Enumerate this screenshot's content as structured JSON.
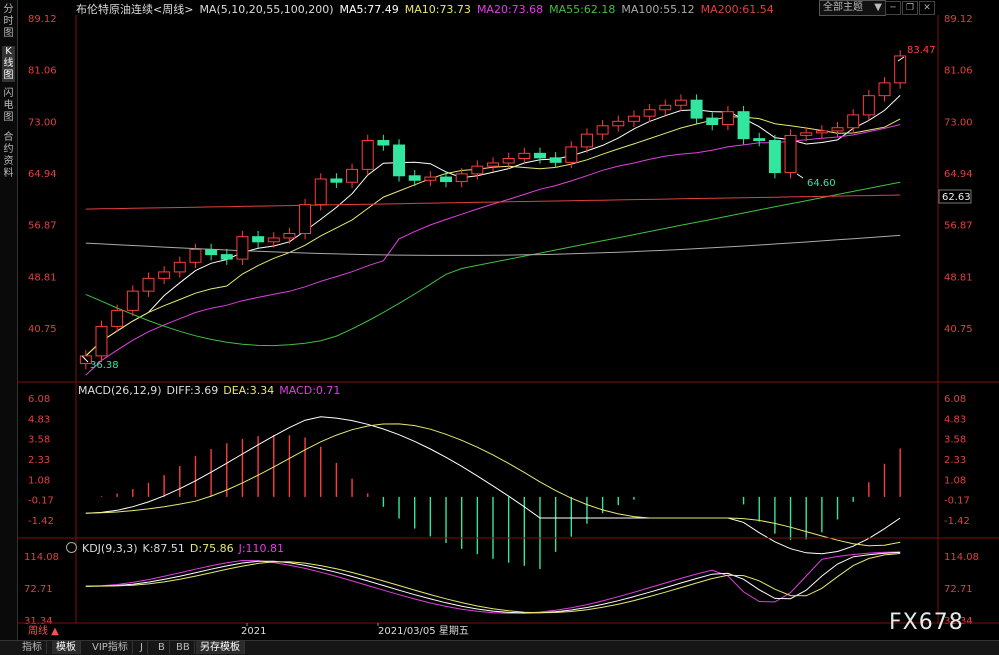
{
  "sidebar": {
    "tabs": [
      {
        "label": "分时图",
        "active": false
      },
      {
        "label": "K线图",
        "active": true
      },
      {
        "label": "闪电图",
        "active": false
      },
      {
        "label": "合约资料",
        "active": false
      }
    ]
  },
  "header": {
    "title": "布伦特原油连续<周线>",
    "ma_label": "MA(5,10,20,55,100,200)",
    "ma5": "MA5:77.49",
    "ma10": "MA10:73.73",
    "ma20": "MA20:73.68",
    "ma55": "MA55:62.18",
    "ma100": "MA100:55.12",
    "ma200": "MA200:61.54",
    "theme": "全部主题",
    "theme_arrow": "▼"
  },
  "colors": {
    "up": "#ff3c3c",
    "down": "#33e6a0",
    "ma5": "#ffffff",
    "ma10": "#e8e870",
    "ma20": "#e040e0",
    "ma55": "#40c040",
    "ma100": "#aaaaaa",
    "ma200": "#e04040",
    "grid": "#7a1010",
    "axis_text": "#e04040"
  },
  "main_chart": {
    "y_ticks": [
      "89.12",
      "81.06",
      "73.00",
      "64.94",
      "56.87",
      "48.81",
      "40.75"
    ],
    "last_price": "62.63",
    "annotations": {
      "high": "83.47",
      "low": "36.38",
      "local_low": "64.60"
    }
  },
  "macd": {
    "header": "MACD(26,12,9)",
    "diff": "DIFF:3.69",
    "dea": "DEA:3.34",
    "macd": "MACD:0.71",
    "y_ticks": [
      "6.08",
      "4.83",
      "3.58",
      "2.33",
      "1.08",
      "-0.17",
      "-1.42"
    ]
  },
  "kdj": {
    "header": "KDJ(9,3,3)",
    "k": "K:87.51",
    "d": "D:75.86",
    "j": "J:110.81",
    "y_ticks": [
      "114.08",
      "72.71",
      "31.34"
    ]
  },
  "x_axis": {
    "period": "周线 ▲",
    "year": "2021",
    "date": "2021/03/05 星期五"
  },
  "bottom_tabs": [
    "指标",
    "模板",
    "VIP指标",
    "J",
    "B",
    "BB",
    "另存模板"
  ],
  "watermark": "FX678"
}
